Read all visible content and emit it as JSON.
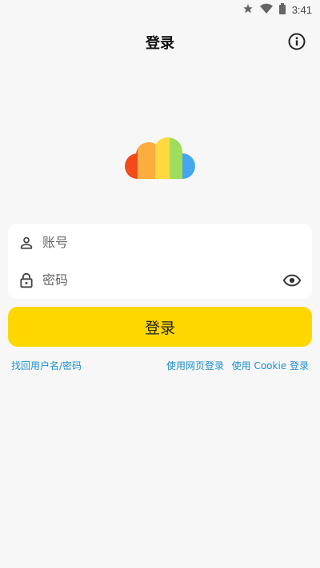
{
  "status_bar": {
    "time": "3:41",
    "icons": [
      "star-icon",
      "wifi-icon",
      "battery-icon"
    ]
  },
  "app_bar": {
    "title": "登录",
    "info_icon": "info-icon"
  },
  "logo": {
    "icon": "cloud-logo",
    "colors": [
      "#f24a1c",
      "#fdad3f",
      "#ffd93f",
      "#9fdd5a",
      "#46a6ee"
    ]
  },
  "form": {
    "account": {
      "icon": "person-icon",
      "placeholder": "账号",
      "value": ""
    },
    "password": {
      "icon": "lock-icon",
      "placeholder": "密码",
      "value": "",
      "toggle_icon": "eye-icon"
    }
  },
  "login_button": {
    "label": "登录",
    "color": "#fed700"
  },
  "links": {
    "recover": "找回用户名/密码",
    "web_login": "使用网页登录",
    "cookie_login": "使用 Cookie 登录",
    "color": "#1f8fcc"
  }
}
